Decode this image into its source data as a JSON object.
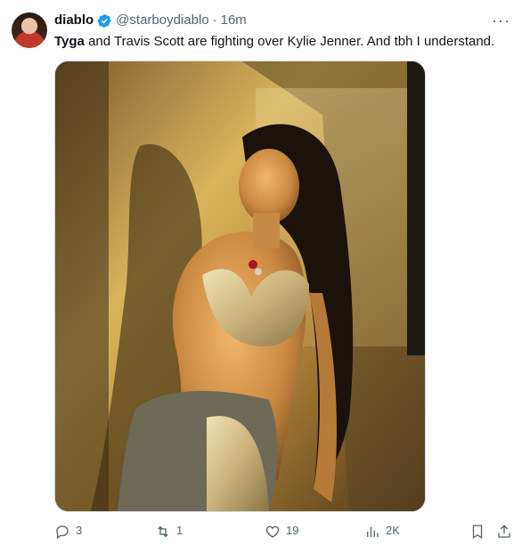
{
  "tweet": {
    "display_name": "diablo",
    "handle": "@starboydiablo",
    "separator": "·",
    "time": "16m",
    "text_bold": "Tyga",
    "text_rest": " and Travis Scott are fighting over Kylie Jenner. And tbh I understand.",
    "more_label": "···"
  },
  "actions": {
    "replies": "3",
    "retweets": "1",
    "likes": "19",
    "views": "2K"
  },
  "icons": {
    "avatar": "avatar",
    "verified": "verified-badge-icon",
    "more": "more-icon",
    "reply": "reply-icon",
    "retweet": "retweet-icon",
    "like": "heart-icon",
    "views": "views-icon",
    "bookmark": "bookmark-icon",
    "share": "share-icon"
  },
  "colors": {
    "verified": "#1d9bf0",
    "muted": "#536471",
    "text": "#0f1419"
  }
}
